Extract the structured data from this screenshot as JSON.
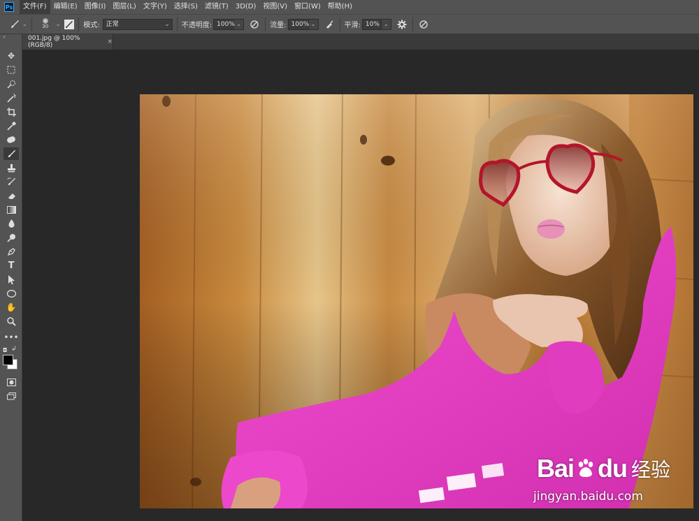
{
  "app": {
    "logo": "Ps"
  },
  "menu": [
    {
      "label": "文件(F)",
      "active": true
    },
    {
      "label": "编辑(E)"
    },
    {
      "label": "图像(I)"
    },
    {
      "label": "图层(L)"
    },
    {
      "label": "文字(Y)"
    },
    {
      "label": "选择(S)"
    },
    {
      "label": "滤镜(T)"
    },
    {
      "label": "3D(D)"
    },
    {
      "label": "视图(V)"
    },
    {
      "label": "窗口(W)"
    },
    {
      "label": "帮助(H)"
    }
  ],
  "options": {
    "brush_size": "30",
    "mode_label": "模式:",
    "mode_value": "正常",
    "opacity_label": "不透明度:",
    "opacity_value": "100%",
    "flow_label": "流量:",
    "flow_value": "100%",
    "smoothing_label": "平滑:",
    "smoothing_value": "10%"
  },
  "document": {
    "tab_title": "001.jpg @ 100%(RGB/8)",
    "close": "×"
  },
  "watermark": {
    "brand_1": "Bai",
    "brand_2": "du",
    "brand_3": "经验",
    "url": "jingyan.baidu.com"
  },
  "colors": {
    "accent": "#31a8ff",
    "ui_bg": "#535353",
    "canvas_bg": "#282828",
    "sweater": "#e63fc4",
    "wood": "#b8762e"
  }
}
